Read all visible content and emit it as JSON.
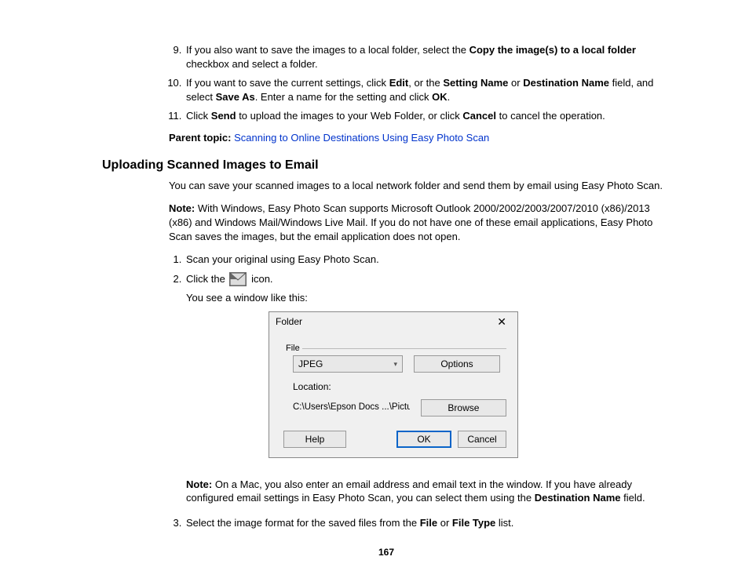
{
  "list1": {
    "i9": {
      "pre": "If you also want to save the images to a local folder, select the ",
      "b1": "Copy the image(s) to a local folder",
      "post": " checkbox and select a folder."
    },
    "i10": {
      "pre": "If you want to save the current settings, click ",
      "b1": "Edit",
      "mid1": ", or the ",
      "b2": "Setting Name",
      "mid2": " or ",
      "b3": "Destination Name",
      "mid3": " field, and select ",
      "b4": "Save As",
      "mid4": ". Enter a name for the setting and click ",
      "b5": "OK",
      "post": "."
    },
    "i11": {
      "pre": "Click ",
      "b1": "Send",
      "mid1": " to upload the images to your Web Folder, or click ",
      "b2": "Cancel",
      "post": " to cancel the operation."
    }
  },
  "parentTopic": {
    "label": "Parent topic:",
    "link": "Scanning to Online Destinations Using Easy Photo Scan"
  },
  "heading": "Uploading Scanned Images to Email",
  "intro": "You can save your scanned images to a local network folder and send them by email using Easy Photo Scan.",
  "note1": {
    "label": "Note:",
    "text": " With Windows, Easy Photo Scan supports Microsoft Outlook 2000/2002/2003/2007/2010 (x86)/2013 (x86) and Windows Mail/Windows Live Mail. If you do not have one of these email applications, Easy Photo Scan saves the images, but the email application does not open."
  },
  "list2": {
    "i1": "Scan your original using Easy Photo Scan.",
    "i2": {
      "pre": "Click the ",
      "post": " icon.",
      "sub": "You see a window like this:"
    },
    "i3": {
      "pre": "Select the image format for the saved files from the ",
      "b1": "File",
      "mid": " or ",
      "b2": "File Type",
      "post": " list."
    }
  },
  "dialog": {
    "title": "Folder",
    "close": "✕",
    "fileLegend": "File",
    "format": "JPEG",
    "options": "Options",
    "locationLabel": "Location:",
    "locationPath": "C:\\Users\\Epson Docs ...\\Pictures",
    "browse": "Browse",
    "help": "Help",
    "ok": "OK",
    "cancel": "Cancel"
  },
  "note2": {
    "label": "Note:",
    "pre": " On a Mac, you also enter an email address and email text in the window. If you have already configured email settings in Easy Photo Scan, you can select them using the ",
    "b1": "Destination Name",
    "post": " field."
  },
  "pageNumber": "167"
}
